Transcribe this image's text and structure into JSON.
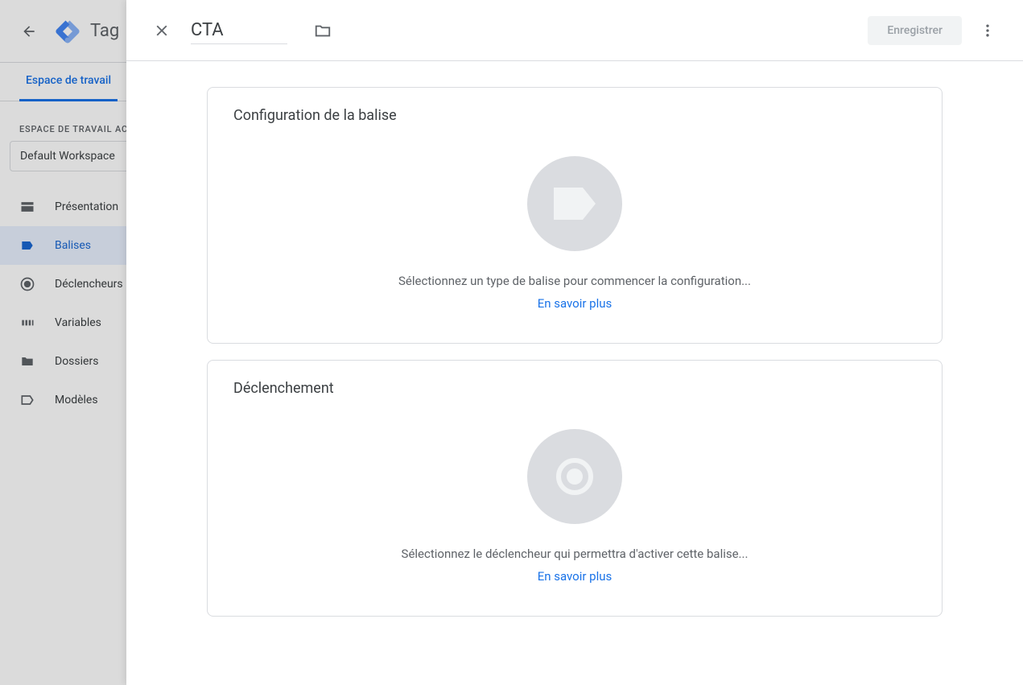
{
  "bg": {
    "title": "Tag",
    "tab": "Espace de travail",
    "workspace_label": "ESPACE DE TRAVAIL ACTUEL",
    "workspace_value": "Default Workspace",
    "nav": [
      {
        "label": "Présentation",
        "icon": "overview"
      },
      {
        "label": "Balises",
        "icon": "tag"
      },
      {
        "label": "Déclencheurs",
        "icon": "trigger"
      },
      {
        "label": "Variables",
        "icon": "variable"
      },
      {
        "label": "Dossiers",
        "icon": "folder"
      },
      {
        "label": "Modèles",
        "icon": "template"
      }
    ]
  },
  "panel": {
    "name": "CTA",
    "save_label": "Enregistrer",
    "cards": {
      "config": {
        "title": "Configuration de la balise",
        "empty_text": "Sélectionnez un type de balise pour commencer la configuration...",
        "learn": "En savoir plus"
      },
      "trigger": {
        "title": "Déclenchement",
        "empty_text": "Sélectionnez le déclencheur qui permettra d'activer cette balise...",
        "learn": "En savoir plus"
      }
    }
  }
}
